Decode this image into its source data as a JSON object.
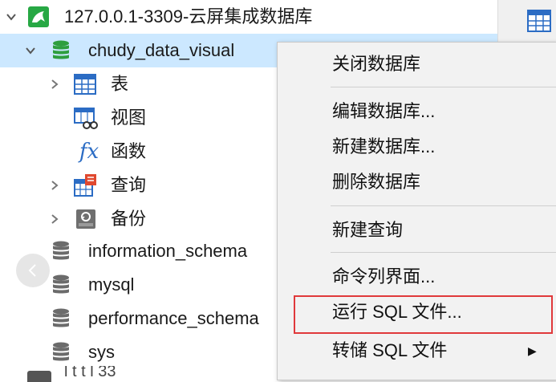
{
  "connection": {
    "label": "127.0.0.1-3309-云屏集成数据库"
  },
  "database": {
    "name": "chudy_data_visual"
  },
  "db_children": [
    {
      "label": "表",
      "icon": "table-icon"
    },
    {
      "label": "视图",
      "icon": "view-icon"
    },
    {
      "label": "函数",
      "icon": "function-icon"
    },
    {
      "label": "查询",
      "icon": "query-icon"
    },
    {
      "label": "备份",
      "icon": "backup-icon"
    }
  ],
  "other_databases": [
    {
      "name": "information_schema"
    },
    {
      "name": "mysql"
    },
    {
      "name": "performance_schema"
    },
    {
      "name": "sys"
    }
  ],
  "function_glyph": "fx",
  "bottom_partial": "l  t            t  l 33",
  "context_menu": {
    "items": [
      {
        "label": "关闭数据库"
      },
      {
        "label": "编辑数据库..."
      },
      {
        "label": "新建数据库..."
      },
      {
        "label": "删除数据库"
      },
      {
        "label": "新建查询"
      },
      {
        "label": "命令列界面..."
      },
      {
        "label": "运行 SQL 文件..."
      },
      {
        "label": "转储 SQL 文件",
        "has_submenu": true
      }
    ],
    "highlighted": "运行 SQL 文件...",
    "highlight_color": "#e0393b"
  },
  "colors": {
    "selection": "#cce8ff",
    "db_active": "#2e9e3e",
    "db_inactive": "#6b6b6b",
    "connection_green": "#27a844",
    "table_blue": "#2b6cc4"
  }
}
